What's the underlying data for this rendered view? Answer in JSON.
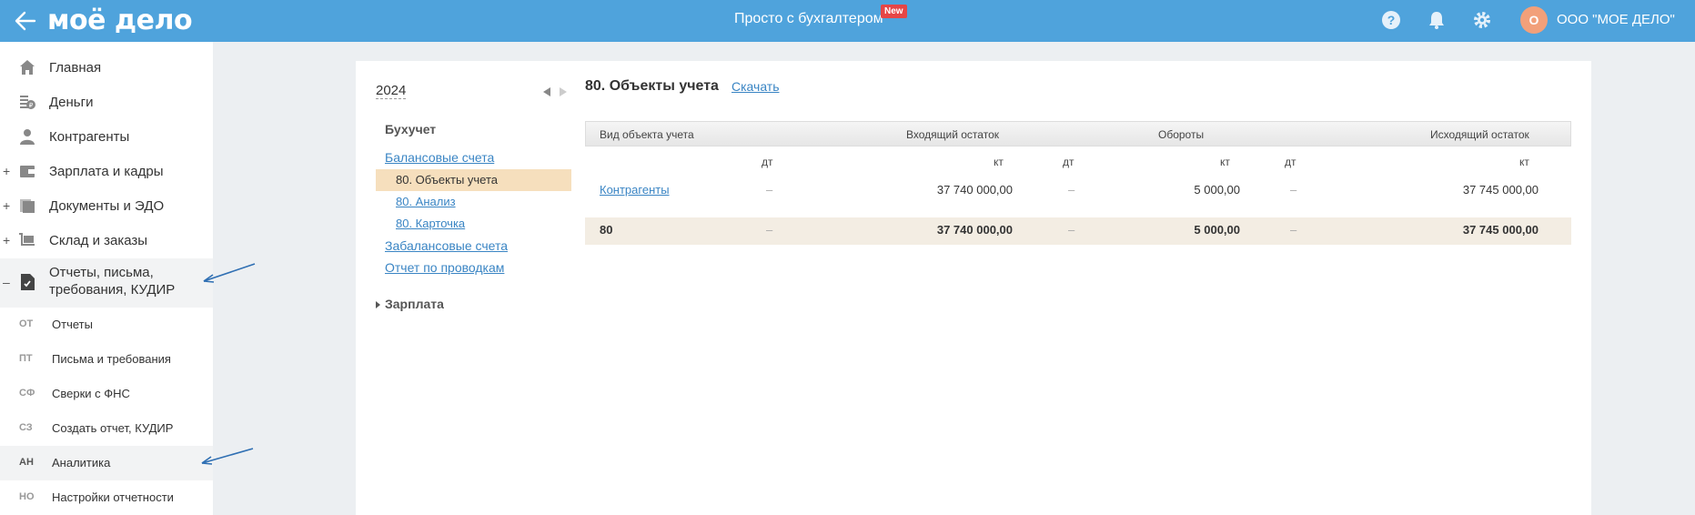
{
  "header": {
    "logo": "моё дело",
    "center_title": "Просто с бухгалтером",
    "new_badge": "New",
    "avatar_letter": "О",
    "company": "ООО \"МОЕ ДЕЛО\""
  },
  "sidebar": {
    "items": [
      {
        "label": "Главная",
        "icon": "home-icon"
      },
      {
        "label": "Деньги",
        "icon": "money-icon"
      },
      {
        "label": "Контрагенты",
        "icon": "contractor-icon"
      },
      {
        "label": "Зарплата и кадры",
        "icon": "wallet-icon",
        "expand": "+"
      },
      {
        "label": "Документы и ЭДО",
        "icon": "documents-icon",
        "expand": "+"
      },
      {
        "label": "Склад и заказы",
        "icon": "warehouse-icon",
        "expand": "+"
      },
      {
        "label_line1": "Отчеты, письма,",
        "label_line2": "требования, КУДИР",
        "icon": "report-icon",
        "expand": "–"
      }
    ],
    "subitems": [
      {
        "abbr": "ОТ",
        "label": "Отчеты"
      },
      {
        "abbr": "ПТ",
        "label": "Письма и требования"
      },
      {
        "abbr": "СФ",
        "label": "Сверки с ФНС"
      },
      {
        "abbr": "СЗ",
        "label": "Создать отчет, КУДИР"
      },
      {
        "abbr": "АН",
        "label": "Аналитика"
      },
      {
        "abbr": "НО",
        "label": "Настройки отчетности"
      }
    ]
  },
  "tree": {
    "year": "2024",
    "section": "Бухучет",
    "balance": "Балансовые счета",
    "selected": "80. Объекты учета",
    "analysis": "80. Анализ",
    "card": "80. Карточка",
    "offbalance": "Забалансовые счета",
    "postings": "Отчет по проводкам",
    "salary": "Зарплата"
  },
  "main": {
    "title": "80. Объекты учета",
    "download": "Скачать"
  },
  "table": {
    "headers": {
      "object": "Вид объекта учета",
      "incoming": "Входящий остаток",
      "turnover": "Обороты",
      "outgoing": "Исходящий остаток"
    },
    "sub": {
      "dt": "дт",
      "kt": "кт"
    },
    "rows": [
      {
        "name": "Контрагенты",
        "in_dt": "–",
        "in_kt": "37 740 000,00",
        "turn_dt": "–",
        "turn_kt": "5 000,00",
        "out_dt": "–",
        "out_kt": "37 745 000,00"
      }
    ],
    "total": {
      "name": "80",
      "in_dt": "–",
      "in_kt": "37 740 000,00",
      "turn_dt": "–",
      "turn_kt": "5 000,00",
      "out_dt": "–",
      "out_kt": "37 745 000,00"
    }
  },
  "colors": {
    "header": "#4fa3dc",
    "link": "#3a85c4",
    "selected": "#f6dfbd",
    "total_row": "#f3ede3"
  }
}
